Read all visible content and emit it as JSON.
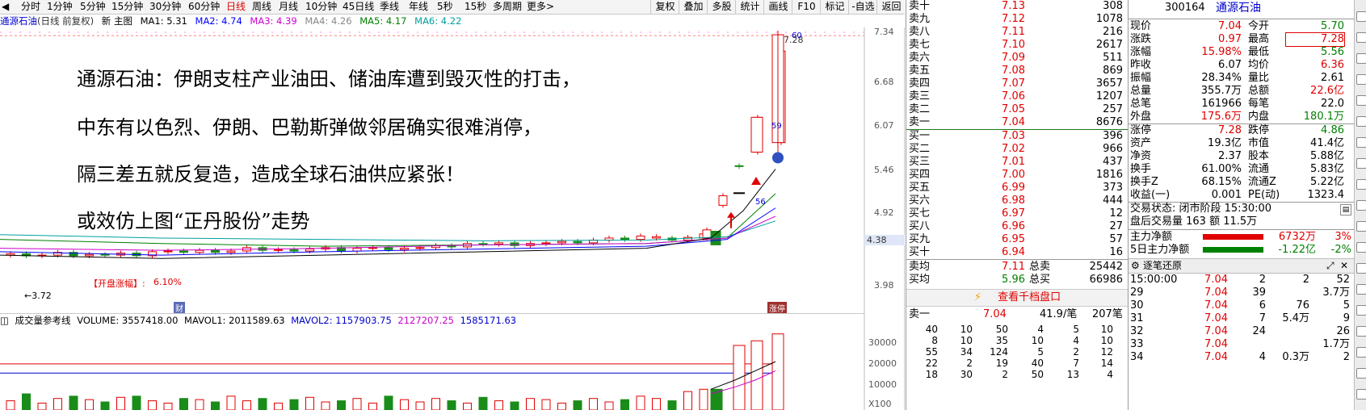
{
  "toolbar": {
    "periods": [
      "分时",
      "1分钟",
      "5分钟",
      "15分钟",
      "30分钟",
      "60分钟",
      "日线",
      "周线",
      "月线",
      "10分钟",
      "45日线",
      "季线",
      "年线",
      "5秒",
      "15秒",
      "多周期",
      "更多>"
    ],
    "active_period": "日线",
    "buttons": [
      "复权",
      "叠加",
      "多股",
      "统计",
      "画线",
      "F10",
      "标记",
      "-自选",
      "返回"
    ]
  },
  "ma_bar": {
    "name": "通源石油",
    "mode": "(日线 前复权)",
    "new_main": "新 主图",
    "ma1": "MA1: 5.31",
    "ma2": "MA2: 4.74",
    "ma3": "MA3: 4.39",
    "ma4": "MA4: 4.26",
    "ma5": "MA5: 4.17",
    "ma6": "MA6: 4.22"
  },
  "price_axis": {
    "ticks": [
      "7.34",
      "6.68",
      "6.07",
      "5.46",
      "4.92",
      "4.38",
      "3.98"
    ],
    "highlight": "4.38"
  },
  "chart_labels": {
    "high": "7.28",
    "low": "←3.72",
    "marker_60": "60",
    "marker_59": "59",
    "marker_56": "56",
    "event_tag": "【开盘涨幅】:",
    "event_val": "6.10%",
    "fin_tag": "财",
    "zt_tag": "涨停"
  },
  "notes": [
    "通源石油：伊朗支柱产业油田、储油库遭到毁灭性的打击，",
    "中东有以色烈、伊朗、巴勒斯弹做邻居确实很难消停，",
    "隔三差五就反复造，造成全球石油供应紧张！",
    "或效仿上图“正丹股份”走势"
  ],
  "vol_bar": {
    "label": "成交量参考线",
    "volume": "VOLUME: 3557418.00",
    "mavol1": "MAVOL1: 2011589.63",
    "mavol2": "MAVOL2: 1157903.75",
    "mavol3": "2127207.25",
    "mavol4": "1585171.63"
  },
  "vol_axis": [
    "30000",
    "20000",
    "10000",
    "X100"
  ],
  "order_book": {
    "asks": [
      {
        "label": "卖十",
        "price": "7.13",
        "vol": "308"
      },
      {
        "label": "卖九",
        "price": "7.12",
        "vol": "1078"
      },
      {
        "label": "卖八",
        "price": "7.11",
        "vol": "216"
      },
      {
        "label": "卖七",
        "price": "7.10",
        "vol": "2617"
      },
      {
        "label": "卖六",
        "price": "7.09",
        "vol": "511"
      },
      {
        "label": "卖五",
        "price": "7.08",
        "vol": "869"
      },
      {
        "label": "卖四",
        "price": "7.07",
        "vol": "3657"
      },
      {
        "label": "卖三",
        "price": "7.06",
        "vol": "1207"
      },
      {
        "label": "卖二",
        "price": "7.05",
        "vol": "257"
      },
      {
        "label": "卖一",
        "price": "7.04",
        "vol": "8676"
      }
    ],
    "bids": [
      {
        "label": "买一",
        "price": "7.03",
        "vol": "396"
      },
      {
        "label": "买二",
        "price": "7.02",
        "vol": "966"
      },
      {
        "label": "买三",
        "price": "7.01",
        "vol": "437"
      },
      {
        "label": "买四",
        "price": "7.00",
        "vol": "1816"
      },
      {
        "label": "买五",
        "price": "6.99",
        "vol": "373"
      },
      {
        "label": "买六",
        "price": "6.98",
        "vol": "444"
      },
      {
        "label": "买七",
        "price": "6.97",
        "vol": "12"
      },
      {
        "label": "买八",
        "price": "6.96",
        "vol": "27"
      },
      {
        "label": "买九",
        "price": "6.95",
        "vol": "57"
      },
      {
        "label": "买十",
        "price": "6.94",
        "vol": "16"
      }
    ],
    "avg_ask": {
      "label": "卖均",
      "price": "7.11",
      "tlabel": "总卖",
      "total": "25442"
    },
    "avg_bid": {
      "label": "买均",
      "price": "5.96",
      "tlabel": "总买",
      "total": "66986"
    },
    "view_1000": "查看千档盘口",
    "l1_label": "卖一",
    "l1_price": "7.04",
    "l1_per": "41.9/笔",
    "l1_count": "207笔",
    "queue": [
      [
        "40",
        "10",
        "50",
        "4",
        "5",
        "10"
      ],
      [
        "8",
        "10",
        "35",
        "10",
        "4",
        "10"
      ],
      [
        "55",
        "34",
        "124",
        "5",
        "2",
        "12"
      ],
      [
        "22",
        "2",
        "19",
        "40",
        "7",
        "14"
      ],
      [
        "18",
        "30",
        "2",
        "50",
        "13",
        "4"
      ]
    ]
  },
  "quote": {
    "code": "300164",
    "name": "通源石油",
    "rows": [
      [
        "现价",
        "7.04",
        "今开",
        "5.70"
      ],
      [
        "涨跌",
        "0.97",
        "最高",
        "7.28"
      ],
      [
        "涨幅",
        "15.98%",
        "最低",
        "5.56"
      ],
      [
        "昨收",
        "6.07",
        "均价",
        "6.36"
      ],
      [
        "振幅",
        "28.34%",
        "量比",
        "2.61"
      ],
      [
        "总量",
        "355.7万",
        "总额",
        "22.6亿"
      ],
      [
        "总笔",
        "161966",
        "每笔",
        "22.0"
      ],
      [
        "外盘",
        "175.6万",
        "内盘",
        "180.1万"
      ],
      [
        "涨停",
        "7.28",
        "跌停",
        "4.86"
      ],
      [
        "资产",
        "19.3亿",
        "市值",
        "41.4亿"
      ],
      [
        "净资",
        "2.37",
        "股本",
        "5.88亿"
      ],
      [
        "换手",
        "61.00%",
        "流通",
        "5.83亿"
      ],
      [
        "换手Z",
        "68.15%",
        "流通Z",
        "5.22亿"
      ],
      [
        "收益(一)",
        "0.001",
        "PE(动)",
        "1323.4"
      ]
    ],
    "trade_status": "交易状态: 闭市阶段 15:30:00",
    "after_hours": "盘后交易量 163 额 11.5万",
    "main_net": {
      "label": "主力净额",
      "val": "6732万",
      "pct": "3%"
    },
    "main_net5": {
      "label": "5日主力净额",
      "val": "-1.22亿",
      "pct": "-2%"
    },
    "ticks_title": "逐笔还原",
    "ticks": [
      [
        "15:00:00",
        "7.04",
        "2",
        "2",
        "52"
      ],
      [
        "29",
        "7.04",
        "39",
        "",
        "3.7万"
      ],
      [
        "30",
        "7.04",
        "6",
        "76",
        "5"
      ],
      [
        "31",
        "7.04",
        "7",
        "5.4万",
        "9"
      ],
      [
        "32",
        "7.04",
        "24",
        "",
        "26"
      ],
      [
        "33",
        "7.04",
        "",
        "",
        "1.7万"
      ],
      [
        "34",
        "7.04",
        "4",
        "0.3万",
        "2"
      ]
    ]
  },
  "colors": {
    "up": "#e00000",
    "down": "#008000",
    "accent": "#0000cc"
  }
}
